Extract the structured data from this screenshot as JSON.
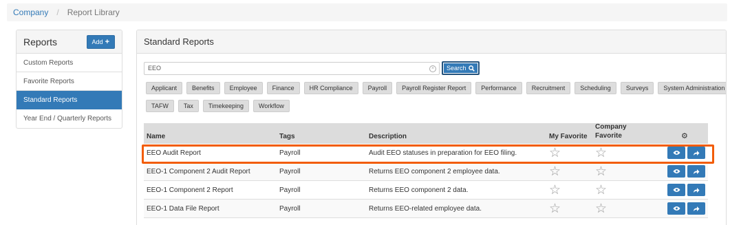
{
  "breadcrumb": {
    "home": "Company",
    "separator": "/",
    "current": "Report Library"
  },
  "sidebar": {
    "title": "Reports",
    "add_label": "Add",
    "items": [
      {
        "label": "Custom Reports",
        "active": false
      },
      {
        "label": "Favorite Reports",
        "active": false
      },
      {
        "label": "Standard Reports",
        "active": true
      },
      {
        "label": "Year End / Quarterly Reports",
        "active": false
      }
    ]
  },
  "main": {
    "title": "Standard Reports",
    "search": {
      "value": "EEO",
      "button_label": "Search"
    },
    "tags_row1": [
      "Applicant",
      "Benefits",
      "Employee",
      "Finance",
      "HR Compliance",
      "Payroll",
      "Payroll Register Report",
      "Performance",
      "Recruitment",
      "Scheduling",
      "Surveys",
      "System Administration"
    ],
    "tags_row2": [
      "TAFW",
      "Tax",
      "Timekeeping",
      "Workflow"
    ],
    "table": {
      "headers": {
        "name": "Name",
        "tags": "Tags",
        "description": "Description",
        "my_favorite": "My Favorite",
        "company_favorite_1": "Company",
        "company_favorite_2": "Favorite"
      },
      "rows": [
        {
          "name": "EEO Audit Report",
          "tags": "Payroll",
          "description": "Audit EEO statuses in preparation for EEO filing."
        },
        {
          "name": "EEO-1 Component 2 Audit Report",
          "tags": "Payroll",
          "description": "Returns EEO component 2 employee data."
        },
        {
          "name": "EEO-1 Component 2 Report",
          "tags": "Payroll",
          "description": "Returns EEO component 2 data."
        },
        {
          "name": "EEO-1 Data File Report",
          "tags": "Payroll",
          "description": "Returns EEO-related employee data."
        }
      ]
    }
  },
  "icons": {
    "star": "☆",
    "gear": "⚙",
    "eye": "👁",
    "share": "↪",
    "search": "search-icon",
    "clear": "×",
    "plus": "+"
  },
  "colors": {
    "primary": "#337ab7",
    "highlight": "#f25c05"
  }
}
